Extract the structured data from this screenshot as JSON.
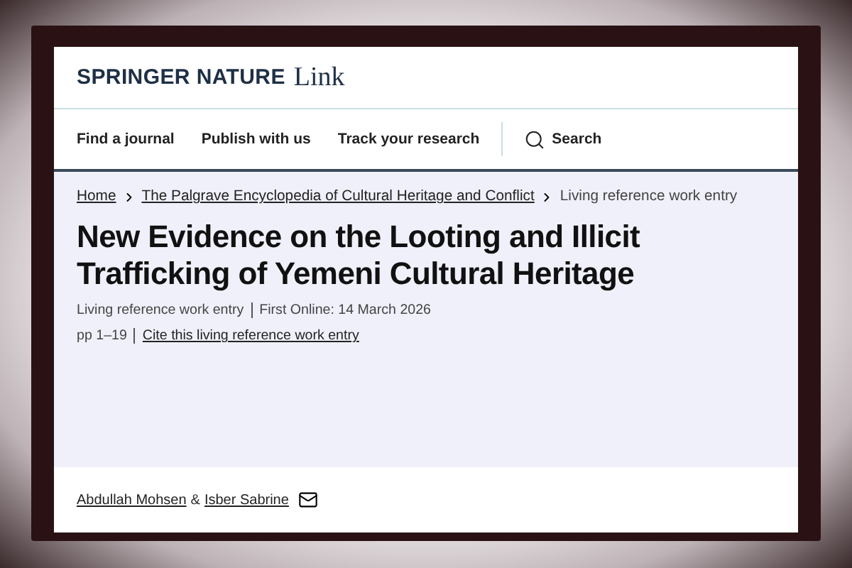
{
  "logo": {
    "brand": "SPRINGER NATURE",
    "product": "Link"
  },
  "nav": {
    "items": [
      "Find a journal",
      "Publish with us",
      "Track your research"
    ],
    "search": "Search"
  },
  "breadcrumbs": [
    {
      "label": "Home",
      "link": true
    },
    {
      "label": "The Palgrave Encyclopedia of Cultural Heritage and Conflict",
      "link": true
    },
    {
      "label": "Living reference work entry",
      "link": false
    }
  ],
  "title": "New Evidence on the Looting and Illicit Trafficking of Yemeni Cultural Heritage",
  "meta": [
    [
      {
        "text": "Living reference work entry",
        "link": false
      },
      {
        "text": "First Online: 14 March 2026",
        "link": false
      }
    ],
    [
      {
        "text": "pp 1–19",
        "link": false
      },
      {
        "text": "Cite this living reference work entry",
        "link": true
      }
    ]
  ],
  "authors": {
    "names": [
      "Abdullah Mohsen",
      "Isber Sabrine"
    ],
    "joiner": "&"
  }
}
